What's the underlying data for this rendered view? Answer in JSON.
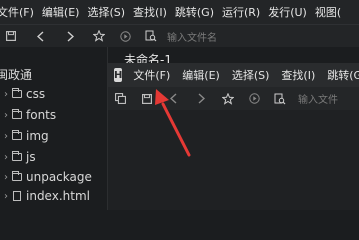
{
  "main_menu": [
    "文件(F)",
    "编辑(E)",
    "选择(S)",
    "查找(I)",
    "跳转(G)",
    "运行(R)",
    "发行(U)",
    "视图("
  ],
  "main_toolbar": {
    "search_placeholder": "输入文件名"
  },
  "sidebar": {
    "project_name": "闽政通",
    "items": [
      {
        "label": "css",
        "type": "folder"
      },
      {
        "label": "fonts",
        "type": "folder"
      },
      {
        "label": "img",
        "type": "folder"
      },
      {
        "label": "js",
        "type": "folder"
      },
      {
        "label": "unpackage",
        "type": "folder"
      },
      {
        "label": "index.html",
        "type": "file"
      }
    ]
  },
  "editor": {
    "tab_title": "未命名-1"
  },
  "second_window": {
    "logo": "H",
    "menu": [
      "文件(F)",
      "编辑(E)",
      "选择(S)",
      "查找(I)",
      "跳转(G)"
    ],
    "search_placeholder": "输入文件"
  },
  "annotation": {
    "arrow_color": "#e53935"
  },
  "icons": [
    "save-icon",
    "back-icon",
    "forward-icon",
    "star-icon",
    "play-icon",
    "preview-icon",
    "copy-icon"
  ]
}
